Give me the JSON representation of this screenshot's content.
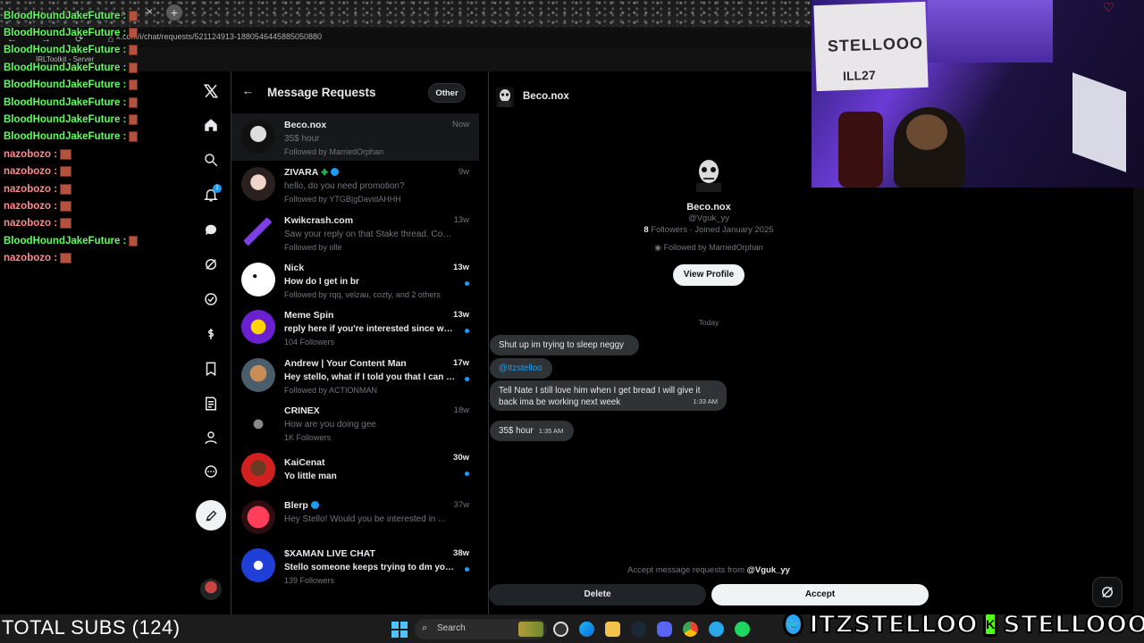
{
  "browser": {
    "url": "x.com/i/chat/requests/521124913-1880546445885050880",
    "bookmark": "IRLToolkit - Server",
    "tab_close": "×",
    "new_tab": "+"
  },
  "chat_overlay": [
    {
      "user": "BloodHoundJakeFuture :",
      "color": "green"
    },
    {
      "user": "BloodHoundJakeFuture :",
      "color": "green"
    },
    {
      "user": "BloodHoundJakeFuture :",
      "color": "green"
    },
    {
      "user": "BloodHoundJakeFuture :",
      "color": "green"
    },
    {
      "user": "BloodHoundJakeFuture :",
      "color": "green"
    },
    {
      "user": "BloodHoundJakeFuture :",
      "color": "green"
    },
    {
      "user": "BloodHoundJakeFuture :",
      "color": "green"
    },
    {
      "user": "BloodHoundJakeFuture :",
      "color": "green"
    },
    {
      "user": "nazobozo :",
      "color": "red"
    },
    {
      "user": "nazobozo :",
      "color": "red"
    },
    {
      "user": "nazobozo :",
      "color": "red"
    },
    {
      "user": "nazobozo :",
      "color": "red"
    },
    {
      "user": "nazobozo :",
      "color": "red"
    },
    {
      "user": "BloodHoundJakeFuture :",
      "color": "green"
    },
    {
      "user": "nazobozo :",
      "color": "red"
    }
  ],
  "nav": {
    "notifications_badge": "1",
    "icons": [
      "x-logo-icon",
      "home-icon",
      "search-icon",
      "bell-icon",
      "messages-icon",
      "grok-icon",
      "verified-icon",
      "money-icon",
      "bookmark-icon",
      "edit-list-icon",
      "profile-icon",
      "more-icon"
    ]
  },
  "requests": {
    "title": "Message Requests",
    "other_button": "Other",
    "back": "←",
    "items": [
      {
        "name": "Beco.nox",
        "time": "Now",
        "preview": "35$ hour",
        "sub": "Followed by MarriedOrphan",
        "unread": false,
        "active": true
      },
      {
        "name": "ZIVARA",
        "time": "9w",
        "preview": "hello, do you need promotion?",
        "sub": "Followed by YTGB|gDavidAHHH",
        "unread": false
      },
      {
        "name": "Kwikcrash.com",
        "time": "13w",
        "preview": "Saw your reply on that Stake thread. Coul...",
        "sub": "Followed by olle",
        "unread": false
      },
      {
        "name": "Nick",
        "time": "13w",
        "preview": "How do I get in br",
        "sub": "Followed by rqq, velzau, cozty, and 2 others",
        "unread": true
      },
      {
        "name": "Meme Spin",
        "time": "13w",
        "preview": "reply here if you're interested since we'd like...",
        "sub": "104 Followers",
        "unread": true
      },
      {
        "name": "Andrew | Your Content Man",
        "time": "17w",
        "preview": "Hey stello, what if I told you that I can get...",
        "sub": "Followed by ACTIONMAN",
        "unread": true
      },
      {
        "name": "CRINEX",
        "time": "18w",
        "preview": "How are you doing gee",
        "sub": "1K Followers",
        "unread": false
      },
      {
        "name": "KaiCenat",
        "time": "30w",
        "preview": "Yo little man",
        "sub": "",
        "unread": true
      },
      {
        "name": "Blerp",
        "time": "37w",
        "preview": "Hey Stello! Would you be interested in ...",
        "sub": "",
        "unread": false
      },
      {
        "name": "$XAMAN LIVE CHAT",
        "time": "38w",
        "preview": "Stello someone keeps trying to dm you ...",
        "sub": "139 Followers",
        "unread": true
      }
    ]
  },
  "conversation": {
    "name": "Beco.nox",
    "profile_name": "Beco.nox",
    "handle": "@Vguk_yy",
    "followers_count": "8",
    "followers_rest": "Followers · Joined January 2025",
    "followed_by": "Followed by MarriedOrphan",
    "view_profile": "View Profile",
    "day_label": "Today",
    "messages": [
      {
        "text": "Shut up im trying to sleep neggy",
        "time": ""
      },
      {
        "text": "@Itzstelloo",
        "time": "",
        "mention": true
      },
      {
        "text": "Tell Nate I still love him when I get bread I will give it back ima be working next week",
        "time": "1:33 AM"
      },
      {
        "text": "35$ hour",
        "time": "1:35 AM"
      }
    ],
    "accept_prefix": "Accept message requests from",
    "accept_handle": "@Vguk_yy",
    "delete_button": "Delete",
    "accept_button": "Accept"
  },
  "webcam": {
    "poster_text": "STELLOOO",
    "poster_sub": "ILL27"
  },
  "taskbar": {
    "search_label": "Search",
    "icons": [
      "windows-icon",
      "search-icon",
      "obs-icon",
      "edge-icon",
      "file-explorer-icon",
      "steam-icon",
      "discord-icon",
      "chrome-icon",
      "telegram-icon",
      "spotify-icon"
    ]
  },
  "overlay_subs": "TOTAL SUBS (124)",
  "social": {
    "twitter": "ITZSTELLOO",
    "kick": "STELLOOO"
  },
  "colors": {
    "accent": "#1d9bf0",
    "chat_green": "#5cff5c",
    "chat_red": "#ff8c8c",
    "kick_green": "#53fc18"
  }
}
